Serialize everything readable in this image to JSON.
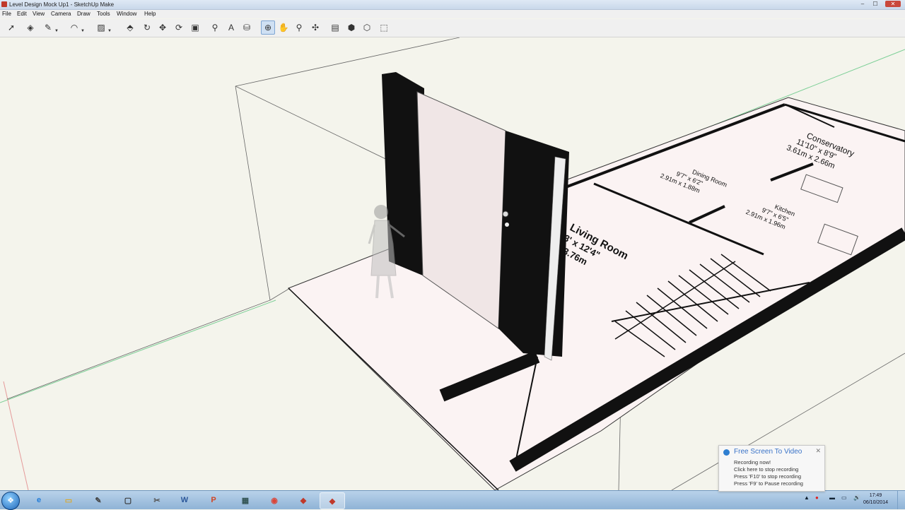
{
  "window": {
    "title": "Level Design Mock Up1 - SketchUp Make",
    "minimize": "–",
    "maximize": "☐",
    "close": "✕"
  },
  "menu": [
    "File",
    "Edit",
    "View",
    "Camera",
    "Draw",
    "Tools",
    "Window",
    "Help"
  ],
  "toolbar": [
    {
      "name": "select-tool",
      "icon": "➚"
    },
    {
      "name": "eraser-tool",
      "icon": "◈"
    },
    {
      "name": "pencil-tool",
      "icon": "✎",
      "dropdown": true
    },
    {
      "name": "arc-tool",
      "icon": "◠",
      "dropdown": true
    },
    {
      "name": "rectangle-tool",
      "icon": "▨",
      "dropdown": true
    },
    {
      "name": "push-pull-tool",
      "icon": "⬘"
    },
    {
      "name": "follow-me-tool",
      "icon": "↻"
    },
    {
      "name": "move-tool",
      "icon": "✥"
    },
    {
      "name": "rotate-tool",
      "icon": "⟳"
    },
    {
      "name": "scale-tool",
      "icon": "▣"
    },
    {
      "name": "tape-measure-tool",
      "icon": "⚲"
    },
    {
      "name": "text-tool",
      "icon": "A"
    },
    {
      "name": "paint-bucket-tool",
      "icon": "⛁"
    },
    {
      "name": "orbit-tool",
      "icon": "⊕",
      "active": true
    },
    {
      "name": "pan-tool",
      "icon": "✋"
    },
    {
      "name": "zoom-tool",
      "icon": "⚲"
    },
    {
      "name": "zoom-extents-tool",
      "icon": "✣"
    },
    {
      "name": "warehouse-tool",
      "icon": "▤"
    },
    {
      "name": "component-tool",
      "icon": "⬢"
    },
    {
      "name": "extension-tool",
      "icon": "⬡"
    },
    {
      "name": "disabled-tool",
      "icon": "⬚"
    }
  ],
  "floorplan": {
    "rooms": [
      {
        "name": "Conservatory",
        "dims": "11'10\" x 8'9\"",
        "metric": "3.61m x 2.66m"
      },
      {
        "name": "Dining Room",
        "dims": "9'7\" x 6'2\"",
        "metric": "2.91m x 1.88m"
      },
      {
        "name": "Kitchen",
        "dims": "9'7\" x 6'5\"",
        "metric": "2.91m x 1.96m"
      },
      {
        "name": "Living Room",
        "dims": "13' x 12'4\"",
        "metric": "x 3.76m"
      }
    ]
  },
  "taskbar": {
    "start": "❖",
    "apps": [
      {
        "name": "internet-explorer",
        "icon": "e",
        "color": "#1f7bd8"
      },
      {
        "name": "file-explorer",
        "icon": "▭",
        "color": "#d9a930"
      },
      {
        "name": "pen-tablet",
        "icon": "✎",
        "color": "#444"
      },
      {
        "name": "generic-window",
        "icon": "▢",
        "color": "#333"
      },
      {
        "name": "paint",
        "icon": "✂",
        "color": "#555"
      },
      {
        "name": "word",
        "icon": "W",
        "color": "#2b579a"
      },
      {
        "name": "powerpoint",
        "icon": "P",
        "color": "#d04423"
      },
      {
        "name": "monitor",
        "icon": "▦",
        "color": "#355"
      },
      {
        "name": "chrome",
        "icon": "◉",
        "color": "#db4437"
      },
      {
        "name": "sketchup-red",
        "icon": "◆",
        "color": "#c0392b"
      },
      {
        "name": "sketchup",
        "icon": "◆",
        "color": "#c0392b",
        "active": true
      }
    ],
    "tray": [
      "▲",
      "●",
      "▬",
      "▭",
      "🔊"
    ],
    "time": "17:49",
    "date": "06/10/2014"
  },
  "popup": {
    "title": "Free Screen To Video",
    "close": "✕",
    "lines": [
      "Recording now!",
      "Click here to stop recording",
      "Press 'F10' to stop recording",
      "Press 'F9' to Pause recording"
    ]
  }
}
